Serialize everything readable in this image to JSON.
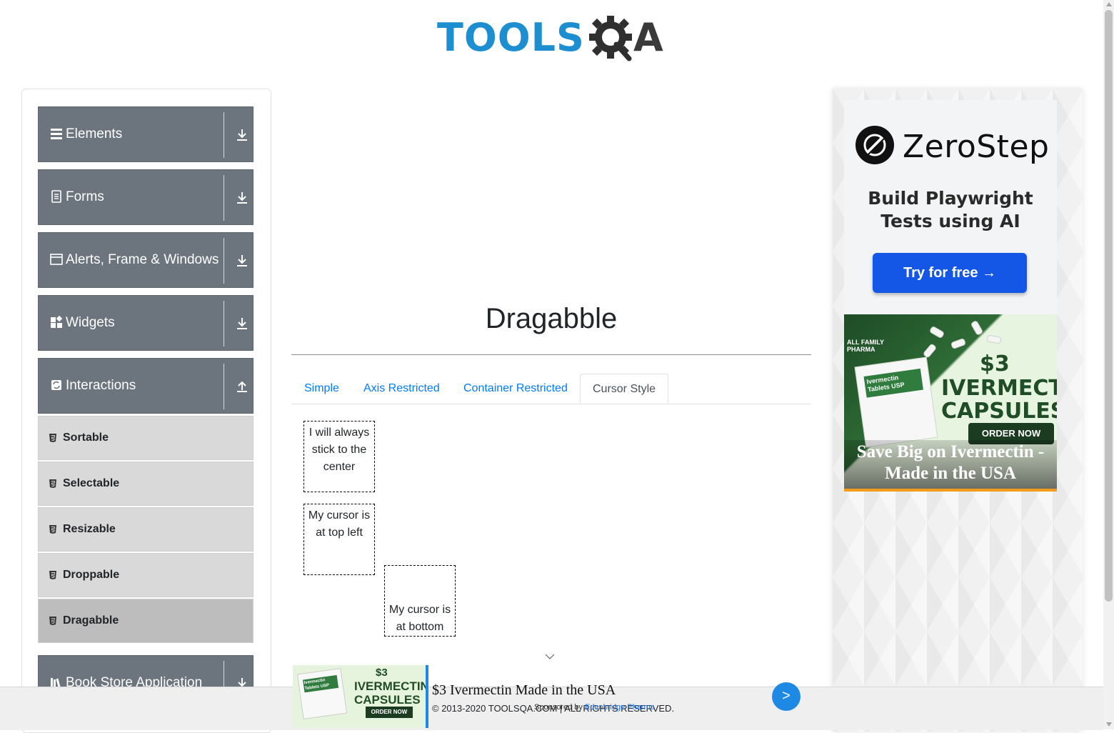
{
  "header": {
    "logo_text": "TOOLS",
    "logo_suffix": "A"
  },
  "sidebar": {
    "groups": [
      {
        "label": "Elements",
        "icon": "hamburger-icon",
        "expanded": false
      },
      {
        "label": "Forms",
        "icon": "document-icon",
        "expanded": false
      },
      {
        "label": "Alerts, Frame & Windows",
        "icon": "window-icon",
        "expanded": false
      },
      {
        "label": "Widgets",
        "icon": "widgets-icon",
        "expanded": false
      },
      {
        "label": "Interactions",
        "icon": "swap-icon",
        "expanded": true
      },
      {
        "label": "Book Store Application",
        "icon": "books-icon",
        "expanded": false
      }
    ],
    "interaction_items": [
      {
        "label": "Sortable",
        "active": false
      },
      {
        "label": "Selectable",
        "active": false
      },
      {
        "label": "Resizable",
        "active": false
      },
      {
        "label": "Droppable",
        "active": false
      },
      {
        "label": "Dragabble",
        "active": true
      }
    ]
  },
  "main": {
    "title": "Dragabble",
    "tabs": [
      {
        "label": "Simple",
        "active": false
      },
      {
        "label": "Axis Restricted",
        "active": false
      },
      {
        "label": "Container Restricted",
        "active": false
      },
      {
        "label": "Cursor Style",
        "active": true
      }
    ],
    "boxes": {
      "center": "I will always stick to the center",
      "top_left": "My cursor is at top left",
      "bottom": "My cursor is at bottom"
    }
  },
  "ads": {
    "zerostep": {
      "brand": "ZeroStep",
      "tagline": "Build Playwright Tests using AI",
      "cta": "Try for free →"
    },
    "ivermectin": {
      "brand_line1": "ALL FAMILY",
      "brand_line2": "PHARMA",
      "pack_text": "Ivermectin Tablets USP",
      "price": "$3",
      "headline_big": "IVERMECTIN CAPSULES",
      "order": "ORDER NOW",
      "caption": "Save Big on Ivermectin - Made in the USA"
    },
    "bottom_banner": {
      "headline": "$3 Ivermectin Made in the USA",
      "sponsor_prefix": "Sponsored by",
      "sponsor_name": "Edenbridge Pharma",
      "next": ">",
      "price": "$3",
      "word1": "IVERMECTIN",
      "word2": "CAPSULES",
      "order": "ORDER NOW",
      "pack_text": "Ivermectin Tablets USP"
    }
  },
  "footer": {
    "copyright": "© 2013-2020 TOOLSQA.COM | ALL RIGHTS RESERVED."
  },
  "colors": {
    "sidebar_group": "#6c757d",
    "link": "#007bff",
    "logo_blue": "#1d8fd0",
    "zerostep_button": "#1457e6"
  }
}
